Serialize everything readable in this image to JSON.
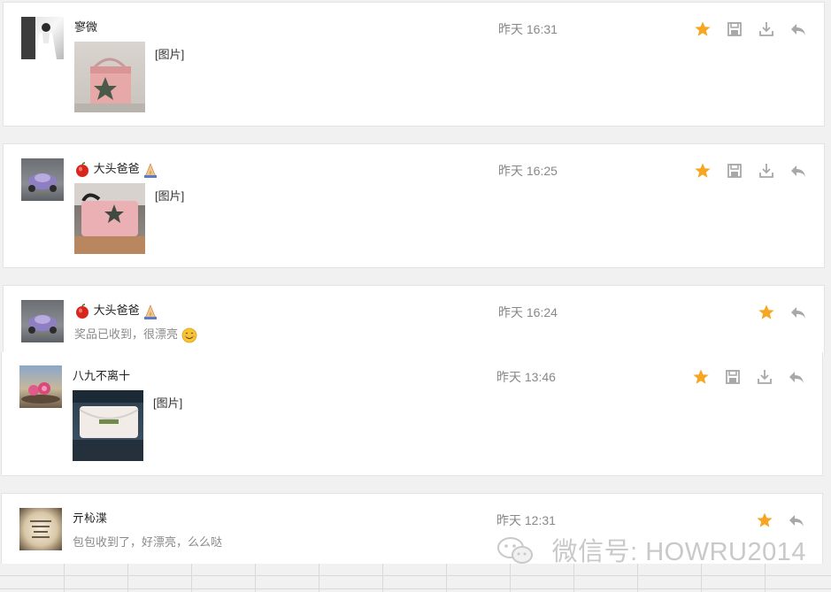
{
  "messages": [
    {
      "name": "寥微",
      "time": "昨天 16:31",
      "image_label": "[图片]",
      "has_image": true,
      "starred": true
    },
    {
      "name": "大头爸爸",
      "time": "昨天 16:25",
      "image_label": "[图片]",
      "has_image": true,
      "starred": true
    },
    {
      "name": "大头爸爸",
      "time": "昨天 16:24",
      "text": "奖品已收到，很漂亮",
      "has_image": false,
      "starred": true
    },
    {
      "name": "八九不离十",
      "time": "昨天 13:46",
      "image_label": "[图片]",
      "has_image": true,
      "starred": true
    },
    {
      "name": "亓杺渫",
      "time": "昨天 12:31",
      "text": "包包收到了，好漂亮，么么哒",
      "has_image": false,
      "starred": true
    }
  ],
  "watermark": "微信号: HOWRU2014",
  "colors": {
    "star": "#f5a623",
    "icon_gray": "#a8a8a8",
    "time_gray": "#888888"
  },
  "icons": {
    "star": "star-icon",
    "save": "save-icon",
    "download": "download-icon",
    "reply": "reply-icon"
  }
}
